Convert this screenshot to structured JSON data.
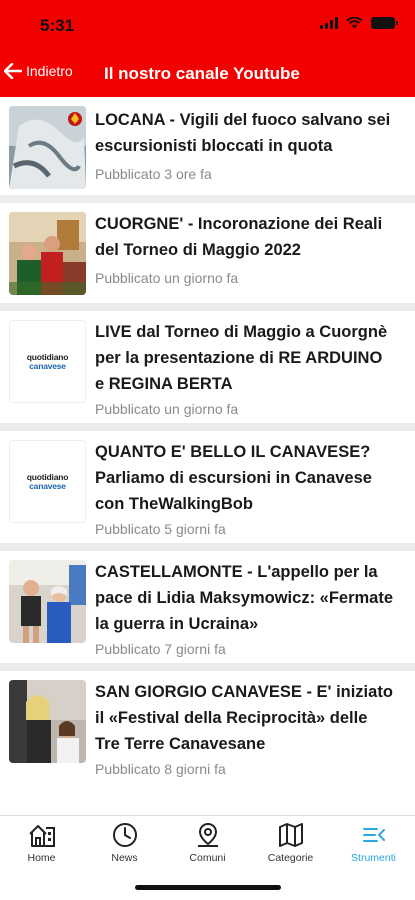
{
  "status": {
    "time": "5:31"
  },
  "nav": {
    "back_label": "Indietro",
    "title": "Il nostro canale Youtube"
  },
  "videos": [
    {
      "title": "LOCANA - Vigili del fuoco salvano sei escursionisti bloccati in quota",
      "published": "Pubblicato 3 ore fa",
      "thumb": "photo"
    },
    {
      "title": "CUORGNE' - Incoronazione dei Reali del Torneo di Maggio 2022",
      "published": "Pubblicato un giorno fa",
      "thumb": "photo"
    },
    {
      "title": "LIVE dal Torneo di Maggio a Cuorgnè per la presentazione di RE ARDUINO e REGINA BERTA",
      "published": "Pubblicato un giorno fa",
      "thumb": "logo"
    },
    {
      "title": "QUANTO E' BELLO IL CANAVESE? Parliamo di escursioni in Canavese con TheWalkingBob",
      "published": "Pubblicato 5 giorni fa",
      "thumb": "logo"
    },
    {
      "title": "CASTELLAMONTE - L'appello per la pace di Lidia Maksymowicz: «Fermate la guerra in Ucraina»",
      "published": "Pubblicato 7 giorni fa",
      "thumb": "photo"
    },
    {
      "title": "SAN GIORGIO CANAVESE - E' iniziato il «Festival della Reciprocità» delle Tre Terre Canavesane",
      "published": "Pubblicato 8 giorni fa",
      "thumb": "photo"
    }
  ],
  "logo": {
    "line1": "quotidiano",
    "line2": "canavese"
  },
  "tabs": [
    {
      "label": "Home",
      "icon": "home-icon"
    },
    {
      "label": "News",
      "icon": "clock-icon"
    },
    {
      "label": "Comuni",
      "icon": "map-pin-icon"
    },
    {
      "label": "Categorie",
      "icon": "map-icon"
    },
    {
      "label": "Strumenti",
      "icon": "tools-icon"
    }
  ],
  "active_tab": "Strumenti",
  "colors": {
    "header": "#f40000",
    "accent": "#28a8e0"
  }
}
